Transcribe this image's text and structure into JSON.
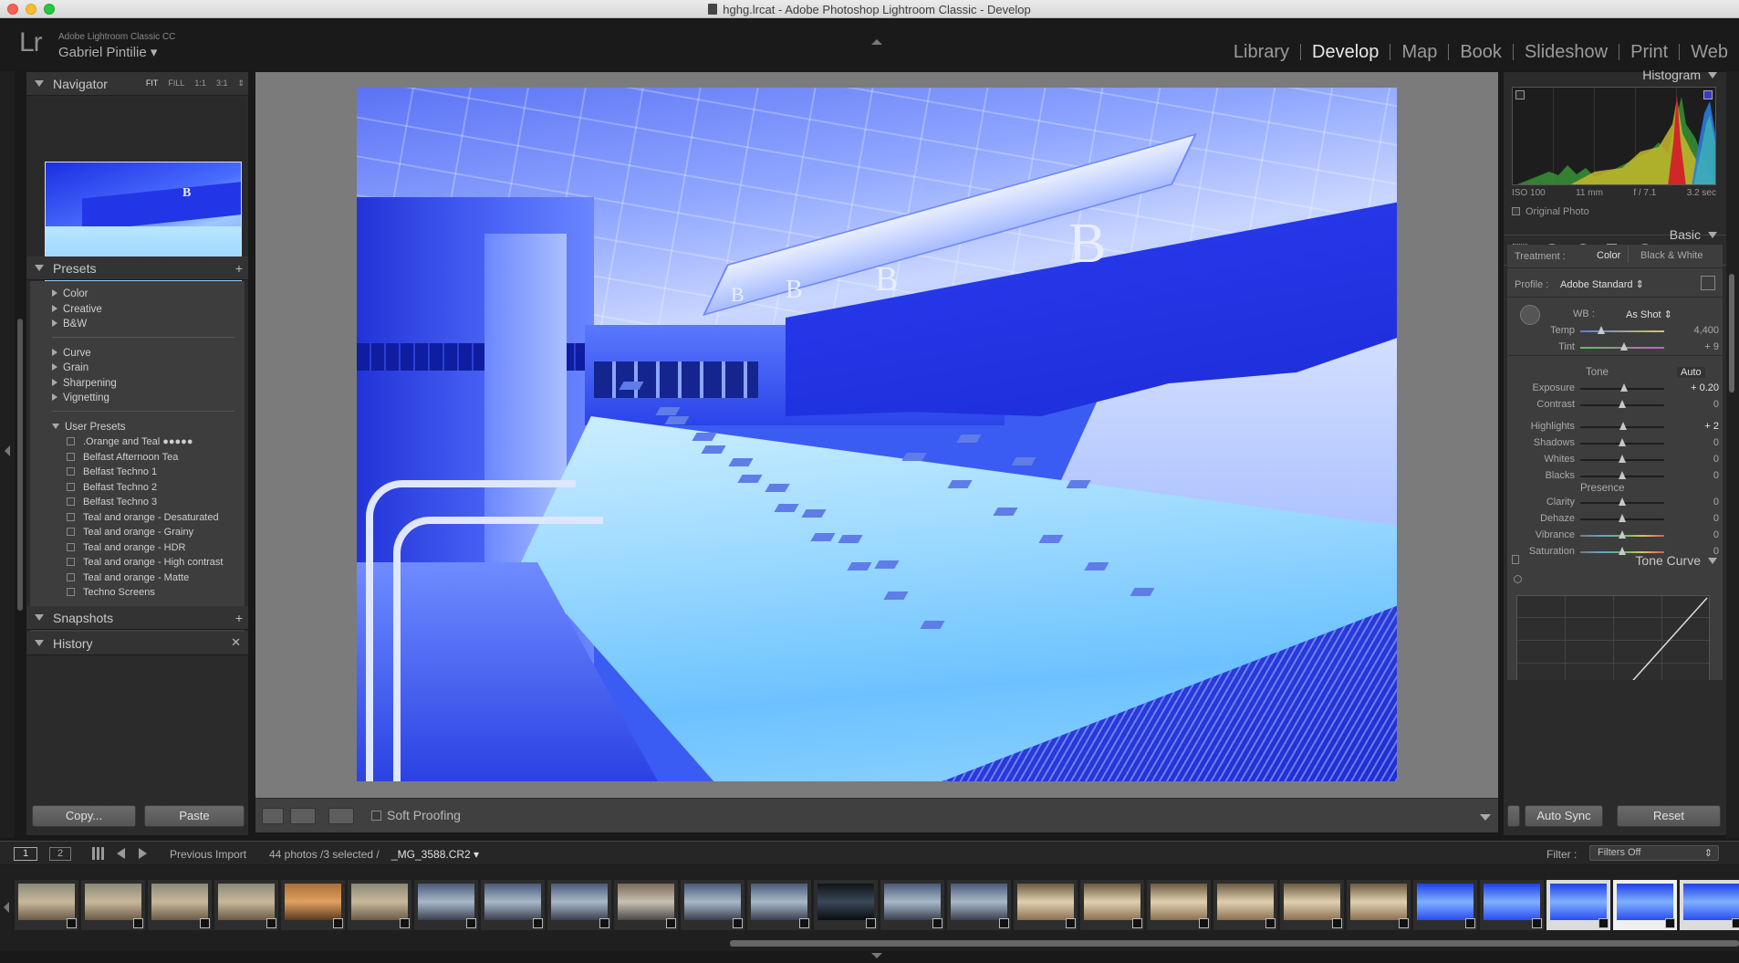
{
  "window": {
    "title": "hghg.lrcat - Adobe Photoshop Lightroom Classic - Develop"
  },
  "identity": {
    "app_name": "Adobe Lightroom Classic CC",
    "user_name": "Gabriel Pintilie ▾",
    "logo": "Lr"
  },
  "modules": [
    "Library",
    "Develop",
    "Map",
    "Book",
    "Slideshow",
    "Print",
    "Web"
  ],
  "active_module": "Develop",
  "navigator": {
    "title": "Navigator",
    "zoom": [
      "FIT",
      "FILL",
      "1:1",
      "3:1"
    ],
    "active_zoom": "FIT"
  },
  "presets": {
    "title": "Presets",
    "groups_a": [
      "Color",
      "Creative",
      "B&W"
    ],
    "groups_b": [
      "Curve",
      "Grain",
      "Sharpening",
      "Vignetting"
    ],
    "user_group": "User Presets",
    "user_presets": [
      ".Orange and Teal ●●●●●",
      "Belfast Afternoon Tea",
      "Belfast Techno 1",
      "Belfast Techno 2",
      "Belfast Techno 3",
      "Teal and orange - Desaturated",
      "Teal and orange - Grainy",
      "Teal and orange - HDR",
      "Teal and orange - High contrast",
      "Teal and orange - Matte",
      "Techno Screens"
    ]
  },
  "snapshots": {
    "title": "Snapshots"
  },
  "history": {
    "title": "History"
  },
  "left_buttons": {
    "copy": "Copy...",
    "paste": "Paste"
  },
  "toolbar": {
    "soft_proofing": "Soft Proofing"
  },
  "histogram": {
    "title": "Histogram",
    "iso": "ISO 100",
    "focal": "11 mm",
    "aperture": "f / 7.1",
    "shutter": "3.2 sec",
    "original_photo": "Original Photo"
  },
  "basic": {
    "title": "Basic",
    "treatment_label": "Treatment :",
    "treatment_color": "Color",
    "treatment_bw": "Black & White",
    "profile_label": "Profile :",
    "profile_value": "Adobe Standard",
    "wb_label": "WB :",
    "wb_value": "As Shot",
    "tone_label": "Tone",
    "auto_label": "Auto",
    "presence_label": "Presence",
    "wb_sliders": [
      {
        "label": "Temp",
        "value": "4,400",
        "pos": 0.25,
        "light": false
      },
      {
        "label": "Tint",
        "value": "+ 9",
        "pos": 0.52,
        "light": false
      }
    ],
    "tone_sliders": [
      {
        "label": "Exposure",
        "value": "+ 0.20",
        "pos": 0.52,
        "light": true
      },
      {
        "label": "Contrast",
        "value": "0",
        "pos": 0.5,
        "light": false
      },
      {
        "label": "Highlights",
        "value": "+ 2",
        "pos": 0.51,
        "light": true
      },
      {
        "label": "Shadows",
        "value": "0",
        "pos": 0.5,
        "light": false
      },
      {
        "label": "Whites",
        "value": "0",
        "pos": 0.5,
        "light": false
      },
      {
        "label": "Blacks",
        "value": "0",
        "pos": 0.5,
        "light": false
      }
    ],
    "presence_sliders": [
      {
        "label": "Clarity",
        "value": "0",
        "pos": 0.5,
        "light": false
      },
      {
        "label": "Dehaze",
        "value": "0",
        "pos": 0.5,
        "light": false
      },
      {
        "label": "Vibrance",
        "value": "0",
        "pos": 0.5,
        "light": false
      },
      {
        "label": "Saturation",
        "value": "0",
        "pos": 0.5,
        "light": false
      }
    ]
  },
  "tone_curve": {
    "title": "Tone Curve"
  },
  "right_buttons": {
    "auto_sync": "Auto Sync",
    "reset": "Reset"
  },
  "filmbar": {
    "view1": "1",
    "view2": "2",
    "source": "Previous Import",
    "count": "44 photos /3 selected /",
    "filename": "_MG_3588.CR2 ▾",
    "filter_label": "Filter :",
    "filter_value": "Filters Off"
  },
  "colors": {
    "accent_photo": "#2236e8",
    "panel": "#2b2b2b",
    "panel_box": "#3d3d3d"
  },
  "filmstrip_thumbs": [
    {
      "tone": "warm"
    },
    {
      "tone": "warm"
    },
    {
      "tone": "warm"
    },
    {
      "tone": "warm"
    },
    {
      "tone": "orange"
    },
    {
      "tone": "warm"
    },
    {
      "tone": "cool"
    },
    {
      "tone": "cool"
    },
    {
      "tone": "cool"
    },
    {
      "tone": "mixed"
    },
    {
      "tone": "cool"
    },
    {
      "tone": "cool"
    },
    {
      "tone": "dark"
    },
    {
      "tone": "cool"
    },
    {
      "tone": "cool"
    },
    {
      "tone": "sepia"
    },
    {
      "tone": "sepia"
    },
    {
      "tone": "sepia"
    },
    {
      "tone": "sepia"
    },
    {
      "tone": "sepia"
    },
    {
      "tone": "sepia"
    },
    {
      "tone": "blue"
    },
    {
      "tone": "blue"
    },
    {
      "tone": "blue",
      "sel": true
    },
    {
      "tone": "blue",
      "sel": true,
      "cur": true
    },
    {
      "tone": "blue",
      "sel": true
    }
  ]
}
